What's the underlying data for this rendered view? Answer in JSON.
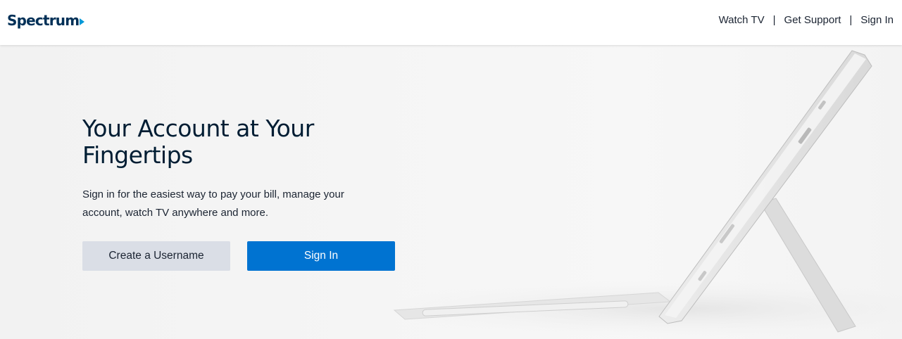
{
  "brand": {
    "name": "Spectrum",
    "color": "#003057",
    "accent": "#0099d8"
  },
  "nav": {
    "items": [
      {
        "label": "Watch TV"
      },
      {
        "label": "Get Support"
      },
      {
        "label": "Sign In"
      }
    ],
    "separator": "|"
  },
  "hero": {
    "title": "Your Account at Your Fingertips",
    "description": "Sign in for the easiest way to pay your bill, manage your account, watch TV anywhere and more.",
    "image_icon": "tablet-with-kickstand-and-stylus"
  },
  "actions": {
    "create_username_label": "Create a Username",
    "sign_in_label": "Sign In",
    "primary_color": "#0073d1",
    "secondary_color": "#dadee6"
  }
}
